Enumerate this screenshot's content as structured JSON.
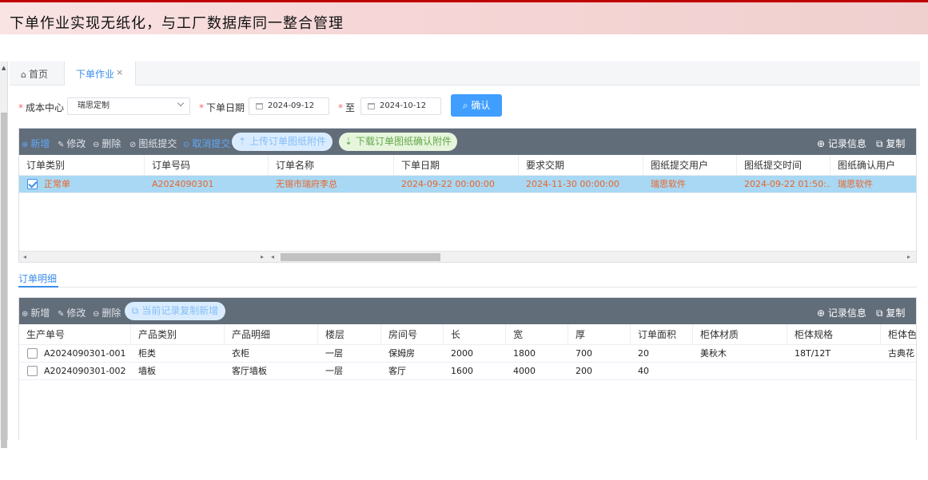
{
  "banner": {
    "title": "下单作业实现无纸化，与工厂数据库同一整合管理"
  },
  "tabs": {
    "home": "首页",
    "active": "下单作业",
    "close": "×"
  },
  "filters": {
    "cost_center_label": "成本中心",
    "cost_center_value": "瑞思定制",
    "order_date_label": "下单日期",
    "date_from": "2024-09-12",
    "to_label": "至",
    "date_to": "2024-10-12",
    "confirm": "确认",
    "required_mark": "*"
  },
  "orders": {
    "toolbar": {
      "add": "新增",
      "edit": "修改",
      "delete": "删除",
      "submit_drawing": "图纸提交",
      "cancel_submit": "取消提交",
      "upload": "上传订单图纸附件",
      "download": "下载订单图纸确认附件",
      "record_info": "记录信息",
      "copy": "复制"
    },
    "columns": [
      "订单类别",
      "订单号码",
      "订单名称",
      "下单日期",
      "要求交期",
      "图纸提交用户",
      "图纸提交时间",
      "图纸确认用户"
    ],
    "rows": [
      {
        "type": "正常单",
        "order_no": "A2024090301",
        "name": "无锡市瑞府李总",
        "order_date": "2024-09-22 00:00:00",
        "due_date": "2024-11-30 00:00:00",
        "submit_user": "瑞思软件",
        "submit_time": "2024-09-22 01:50:...",
        "confirm_user": "瑞思软件",
        "checked": true
      }
    ]
  },
  "detail": {
    "tab_label": "订单明细",
    "toolbar": {
      "add": "新增",
      "edit": "修改",
      "delete": "删除",
      "copy_new": "当前记录复制新增",
      "record_info": "记录信息",
      "copy": "复制"
    },
    "columns": [
      "生产单号",
      "产品类别",
      "产品明细",
      "楼层",
      "房间号",
      "长",
      "宽",
      "厚",
      "订单面积",
      "柜体材质",
      "柜体规格",
      "柜体色"
    ],
    "rows": [
      {
        "prod_no": "A2024090301-001",
        "category": "柜类",
        "detail": "衣柜",
        "floor": "一层",
        "room": "保姆房",
        "length": "2000",
        "width": "1800",
        "thick": "700",
        "area": "20",
        "material": "美秋木",
        "spec": "18T/12T",
        "color": "古典花"
      },
      {
        "prod_no": "A2024090301-002",
        "category": "墙板",
        "detail": "客厅墙板",
        "floor": "一层",
        "room": "客厅",
        "length": "1600",
        "width": "4000",
        "thick": "200",
        "area": "40",
        "material": "",
        "spec": "",
        "color": ""
      }
    ]
  },
  "colors": {
    "accent": "#409eff",
    "toolbar_bg": "#626d7a",
    "selected_row": "#a8d8f3",
    "selected_text": "#e8642a",
    "banner_red": "#c00000"
  },
  "icons": [
    "home-icon",
    "close-icon",
    "calendar-icon",
    "chevron-down-icon",
    "search-icon",
    "plus-circle-icon",
    "edit-icon",
    "minus-circle-icon",
    "check-circle-icon",
    "upload-icon",
    "download-icon",
    "zoom-icon",
    "copy-icon"
  ]
}
